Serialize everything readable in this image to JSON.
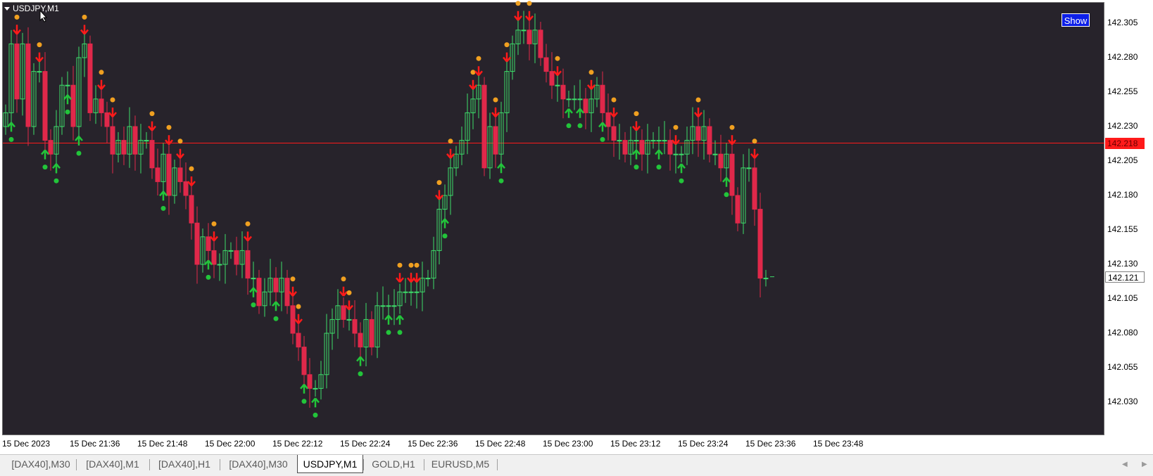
{
  "symbol_title": "USDJPY,M1",
  "show_button": "Show",
  "price_scale": {
    "ticks": [
      "142.305",
      "142.280",
      "142.255",
      "142.230",
      "142.205",
      "142.180",
      "142.155",
      "142.130",
      "142.105",
      "142.080",
      "142.055",
      "142.030"
    ],
    "tick_values": [
      142.305,
      142.28,
      142.255,
      142.23,
      142.205,
      142.18,
      142.155,
      142.13,
      142.105,
      142.08,
      142.055,
      142.03
    ],
    "horizontal_line_value": 142.218,
    "horizontal_line_label": "142.218",
    "current_price_value": 142.121,
    "current_price_label": "142.121"
  },
  "time_scale": {
    "labels": [
      "15 Dec 2023",
      "15 Dec 21:36",
      "15 Dec 21:48",
      "15 Dec 22:00",
      "15 Dec 22:12",
      "15 Dec 22:24",
      "15 Dec 22:36",
      "15 Dec 22:48",
      "15 Dec 23:00",
      "15 Dec 23:12",
      "15 Dec 23:24",
      "15 Dec 23:36",
      "15 Dec 23:48"
    ]
  },
  "tabs": [
    {
      "label": "[DAX40],M30",
      "active": false
    },
    {
      "label": "[DAX40],M1",
      "active": false
    },
    {
      "label": "[DAX40],H1",
      "active": false
    },
    {
      "label": "[DAX40],M30",
      "active": false
    },
    {
      "label": "USDJPY,M1",
      "active": true
    },
    {
      "label": "GOLD,H1",
      "active": false
    },
    {
      "label": "EURUSD,M5",
      "active": false
    }
  ],
  "colors": {
    "background": "#27232b",
    "bull_candle": "#3ddc6a",
    "bear_candle": "#e0284a",
    "sell_arrow": "#ff1a1a",
    "buy_arrow": "#22c43a",
    "sell_dot": "#f0a020",
    "buy_dot": "#22c43a",
    "horizontal_line": "#ff1a1a"
  },
  "chart_data": {
    "type": "candlestick",
    "ylim": [
      142.02,
      142.315
    ],
    "candles_close_path": [
      142.24,
      142.29,
      142.25,
      142.29,
      142.23,
      142.27,
      142.27,
      142.22,
      142.21,
      142.23,
      142.26,
      142.26,
      142.23,
      142.28,
      142.29,
      142.24,
      142.25,
      142.24,
      142.23,
      142.21,
      142.22,
      142.21,
      142.23,
      142.21,
      142.22,
      142.22,
      142.2,
      142.19,
      142.21,
      142.18,
      142.2,
      142.19,
      142.18,
      142.16,
      142.13,
      142.15,
      142.14,
      142.13,
      142.13,
      142.14,
      142.14,
      142.13,
      142.14,
      142.12,
      142.12,
      142.1,
      142.11,
      142.12,
      142.11,
      142.12,
      142.1,
      142.08,
      142.07,
      142.05,
      142.04,
      142.04,
      142.05,
      142.08,
      142.09,
      142.1,
      142.09,
      142.09,
      142.08,
      142.07,
      142.09,
      142.07,
      142.1,
      142.1,
      142.1,
      142.1,
      142.11,
      142.11,
      142.11,
      142.11,
      142.12,
      142.12,
      142.14,
      142.17,
      142.18,
      142.2,
      142.21,
      142.22,
      142.24,
      142.25,
      142.26,
      142.2,
      142.23,
      142.21,
      142.24,
      142.27,
      142.29,
      142.3,
      142.3,
      142.29,
      142.3,
      142.28,
      142.27,
      142.26,
      142.26,
      142.25,
      142.25,
      142.25,
      142.25,
      142.24,
      142.25,
      142.26,
      142.24,
      142.23,
      142.22,
      142.22,
      142.21,
      142.22,
      142.22,
      142.21,
      142.22,
      142.22,
      142.22,
      142.22,
      142.21,
      142.21,
      142.21,
      142.22,
      142.23,
      142.22,
      142.23,
      142.21,
      142.21,
      142.2,
      142.21,
      142.18,
      142.16,
      142.2,
      142.2,
      142.17,
      142.12,
      142.12
    ],
    "sell_signal_indices": [
      2,
      6,
      14,
      17,
      19,
      26,
      29,
      31,
      33,
      37,
      43,
      51,
      52,
      60,
      61,
      70,
      72,
      73,
      77,
      79,
      83,
      84,
      87,
      89,
      91,
      93,
      98,
      104,
      108,
      112,
      119,
      123,
      129,
      133,
      137
    ],
    "buy_signal_indices": [
      1,
      7,
      9,
      11,
      13,
      28,
      36,
      44,
      48,
      53,
      55,
      63,
      68,
      70,
      78,
      88,
      100,
      102,
      106,
      112,
      116,
      120,
      128
    ]
  }
}
